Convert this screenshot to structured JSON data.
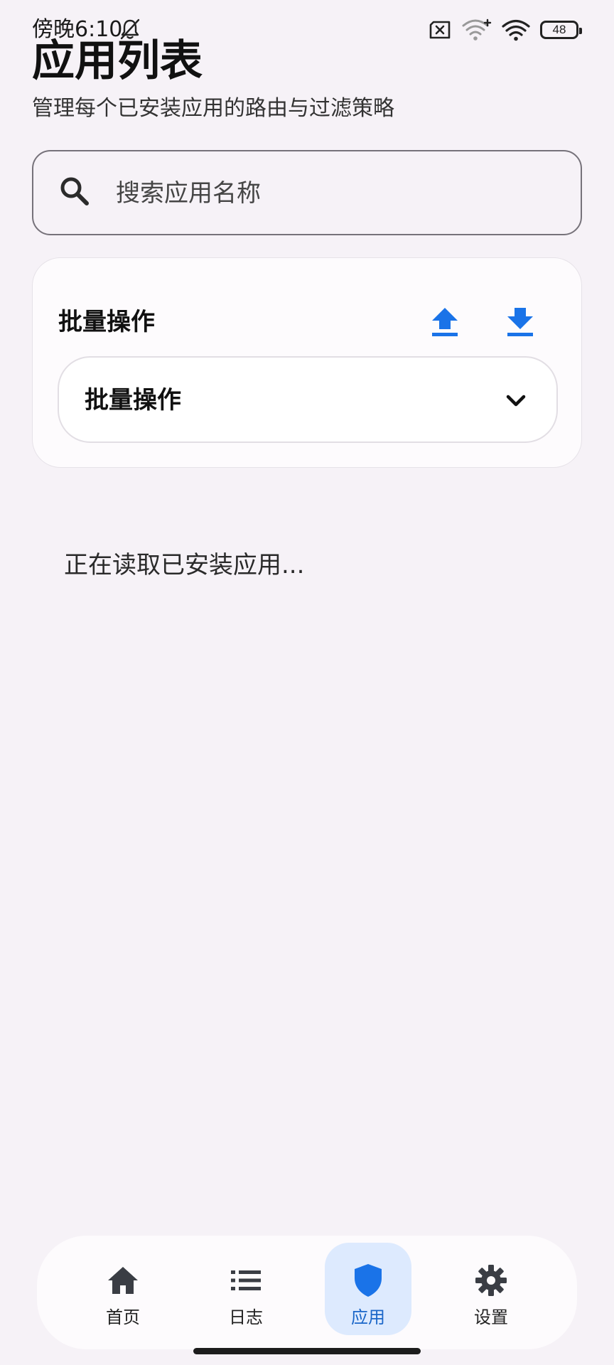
{
  "status_bar": {
    "time": "傍晚6:10",
    "battery": "48"
  },
  "header": {
    "title": "应用列表",
    "subtitle": "管理每个已安装应用的路由与过滤策略"
  },
  "search": {
    "placeholder": "搜索应用名称",
    "value": ""
  },
  "batch": {
    "title": "批量操作",
    "select_value": "批量操作",
    "accent_color": "#1a73e8"
  },
  "content": {
    "loading_text": "正在读取已安装应用..."
  },
  "bottom_nav": {
    "items": [
      {
        "label": "首页",
        "icon": "home-icon"
      },
      {
        "label": "日志",
        "icon": "list-icon"
      },
      {
        "label": "应用",
        "icon": "shield-icon",
        "active": true
      },
      {
        "label": "设置",
        "icon": "gear-icon"
      }
    ],
    "active_color": "#1a66c8",
    "active_bg": "#ddeafe"
  }
}
